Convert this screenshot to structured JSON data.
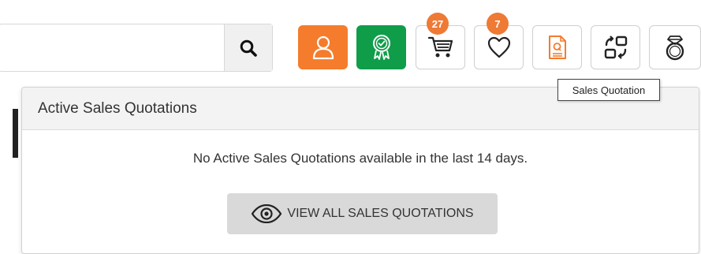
{
  "search": {
    "value": "",
    "placeholder": "",
    "icon": "search-icon"
  },
  "toolbar": {
    "account_icon": "user-icon",
    "award_icon": "award-ribbon-icon",
    "cart": {
      "icon": "cart-icon",
      "count": "27"
    },
    "wishlist": {
      "icon": "heart-icon",
      "count": "7"
    },
    "quotation_icon": "quotation-document-icon",
    "exchange_icon": "exchange-icon",
    "ring_icon": "ring-icon",
    "accent_orange": "#f47c2c",
    "accent_green": "#0f9d4a",
    "badge_color": "#ee7a36"
  },
  "tooltip": {
    "text": "Sales Quotation"
  },
  "panel": {
    "title": "Active Sales Quotations",
    "message": "No Active Sales Quotations available in the last 14 days.",
    "view_all_label": "VIEW ALL SALES QUOTATIONS",
    "view_all_icon": "eye-icon"
  }
}
